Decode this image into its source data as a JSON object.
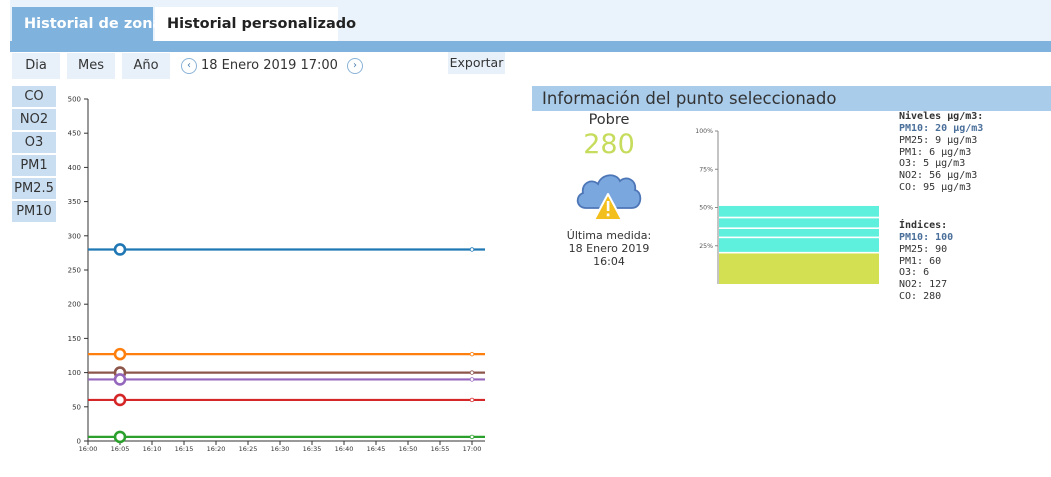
{
  "tabs": [
    {
      "label": "Historial de zona"
    },
    {
      "label": "Historial personalizado"
    }
  ],
  "period_buttons": [
    {
      "label": "Dia"
    },
    {
      "label": "Mes"
    },
    {
      "label": "Año"
    }
  ],
  "date_label": "18 Enero 2019 17:00",
  "export_label": "Exportar",
  "pollutant_buttons": [
    {
      "label": "CO"
    },
    {
      "label": "NO2"
    },
    {
      "label": "O3"
    },
    {
      "label": "PM1"
    },
    {
      "label": "PM2.5"
    },
    {
      "label": "PM10"
    }
  ],
  "info": {
    "title": "Información del punto seleccionado",
    "quality": "Pobre",
    "value": "280",
    "value_color": "#c6dc5c",
    "last_label": "Última medida:",
    "last_date": "18 Enero 2019",
    "last_time": "16:04",
    "levels_title": "Niveles µg/m3:",
    "levels": [
      {
        "text": "PM10: 20 µg/m3",
        "highlight": true
      },
      {
        "text": "PM25: 9 µg/m3",
        "highlight": false
      },
      {
        "text": "PM1: 6 µg/m3",
        "highlight": false
      },
      {
        "text": "O3: 5 µg/m3",
        "highlight": false
      },
      {
        "text": "NO2: 56 µg/m3",
        "highlight": false
      },
      {
        "text": "CO: 95 µg/m3",
        "highlight": false
      }
    ],
    "indices_title": "Índices:",
    "indices": [
      {
        "text": "PM10: 100",
        "highlight": true
      },
      {
        "text": "PM25: 90",
        "highlight": false
      },
      {
        "text": "PM1: 60",
        "highlight": false
      },
      {
        "text": "O3: 6",
        "highlight": false
      },
      {
        "text": "NO2: 127",
        "highlight": false
      },
      {
        "text": "CO: 280",
        "highlight": false
      }
    ]
  },
  "icons": {
    "prev": "chevron-left-icon",
    "next": "chevron-right-icon",
    "weather": "cloud-warning-icon"
  },
  "chart_data": [
    {
      "type": "line",
      "title": "",
      "xlabel": "",
      "ylabel": "",
      "x": [
        "16:00",
        "16:05",
        "16:10",
        "16:15",
        "16:20",
        "16:25",
        "16:30",
        "16:35",
        "16:40",
        "16:45",
        "16:50",
        "16:55",
        "17:00"
      ],
      "ylim": [
        0,
        500
      ],
      "yticks": [
        0,
        50,
        100,
        150,
        200,
        250,
        300,
        350,
        400,
        450,
        500
      ],
      "grid": false,
      "selected_x": "16:05",
      "series": [
        {
          "color": "#1f77b4",
          "value": 280
        },
        {
          "color": "#ff7f0e",
          "value": 127
        },
        {
          "color": "#8c564b",
          "value": 100
        },
        {
          "color": "#9467bd",
          "value": 90
        },
        {
          "color": "#d62728",
          "value": 60
        },
        {
          "color": "#2ca02c",
          "value": 6
        }
      ]
    },
    {
      "type": "bar",
      "title": "",
      "ylim": [
        0,
        100
      ],
      "yticks": [
        "100%",
        "75%",
        "50%",
        "25%"
      ],
      "segments": [
        {
          "color": "#d3e052",
          "value": 20
        },
        {
          "color": "#ffffff",
          "value": 1
        },
        {
          "color": "#5ef0dd",
          "value": 9
        },
        {
          "color": "#ffffff",
          "value": 1
        },
        {
          "color": "#5ef0dd",
          "value": 5
        },
        {
          "color": "#ffffff",
          "value": 1
        },
        {
          "color": "#5ef0dd",
          "value": 6
        },
        {
          "color": "#ffffff",
          "value": 1
        },
        {
          "color": "#5ef0dd",
          "value": 7
        }
      ]
    }
  ]
}
